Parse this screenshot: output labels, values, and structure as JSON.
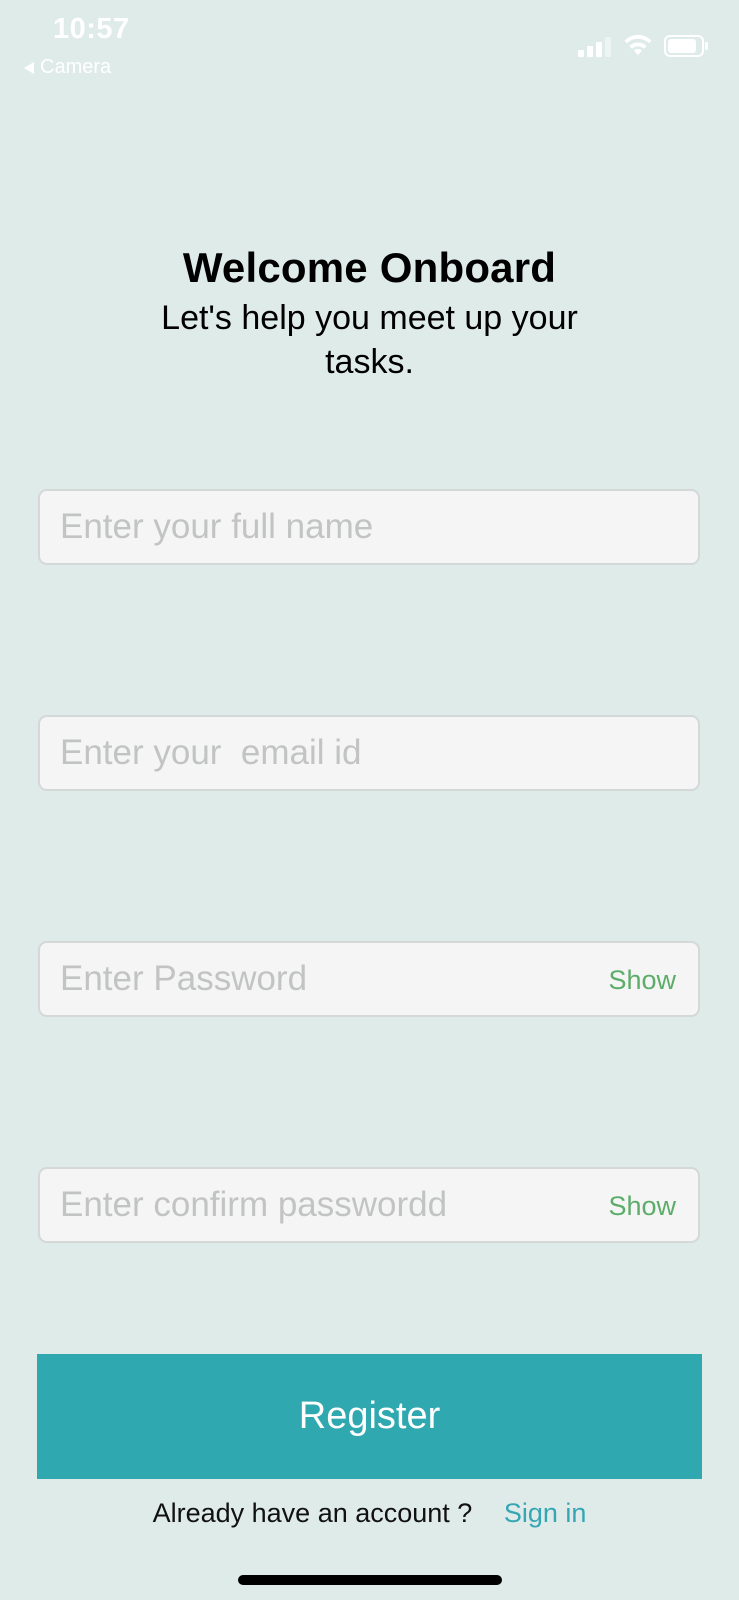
{
  "status_bar": {
    "time": "10:57",
    "back_label": "Camera",
    "icons": [
      "cellular-signal-icon",
      "wifi-icon",
      "battery-icon"
    ]
  },
  "header": {
    "title": "Welcome Onboard",
    "subtitle": "Let's help you meet up your tasks."
  },
  "form": {
    "full_name": {
      "placeholder": "Enter your full name",
      "value": ""
    },
    "email": {
      "placeholder": "Enter your  email id",
      "value": ""
    },
    "password": {
      "placeholder": "Enter Password",
      "value": "",
      "toggle_label": "Show"
    },
    "confirm_password": {
      "placeholder": "Enter confirm passwordd",
      "value": "",
      "toggle_label": "Show"
    }
  },
  "actions": {
    "register_label": "Register"
  },
  "footer": {
    "question": "Already have an account ?",
    "signin_label": "Sign in"
  },
  "colors": {
    "background": "#dfebe8",
    "accent": "#2fa8b0",
    "show_toggle": "#5cad6a",
    "link": "#36a6b4"
  }
}
